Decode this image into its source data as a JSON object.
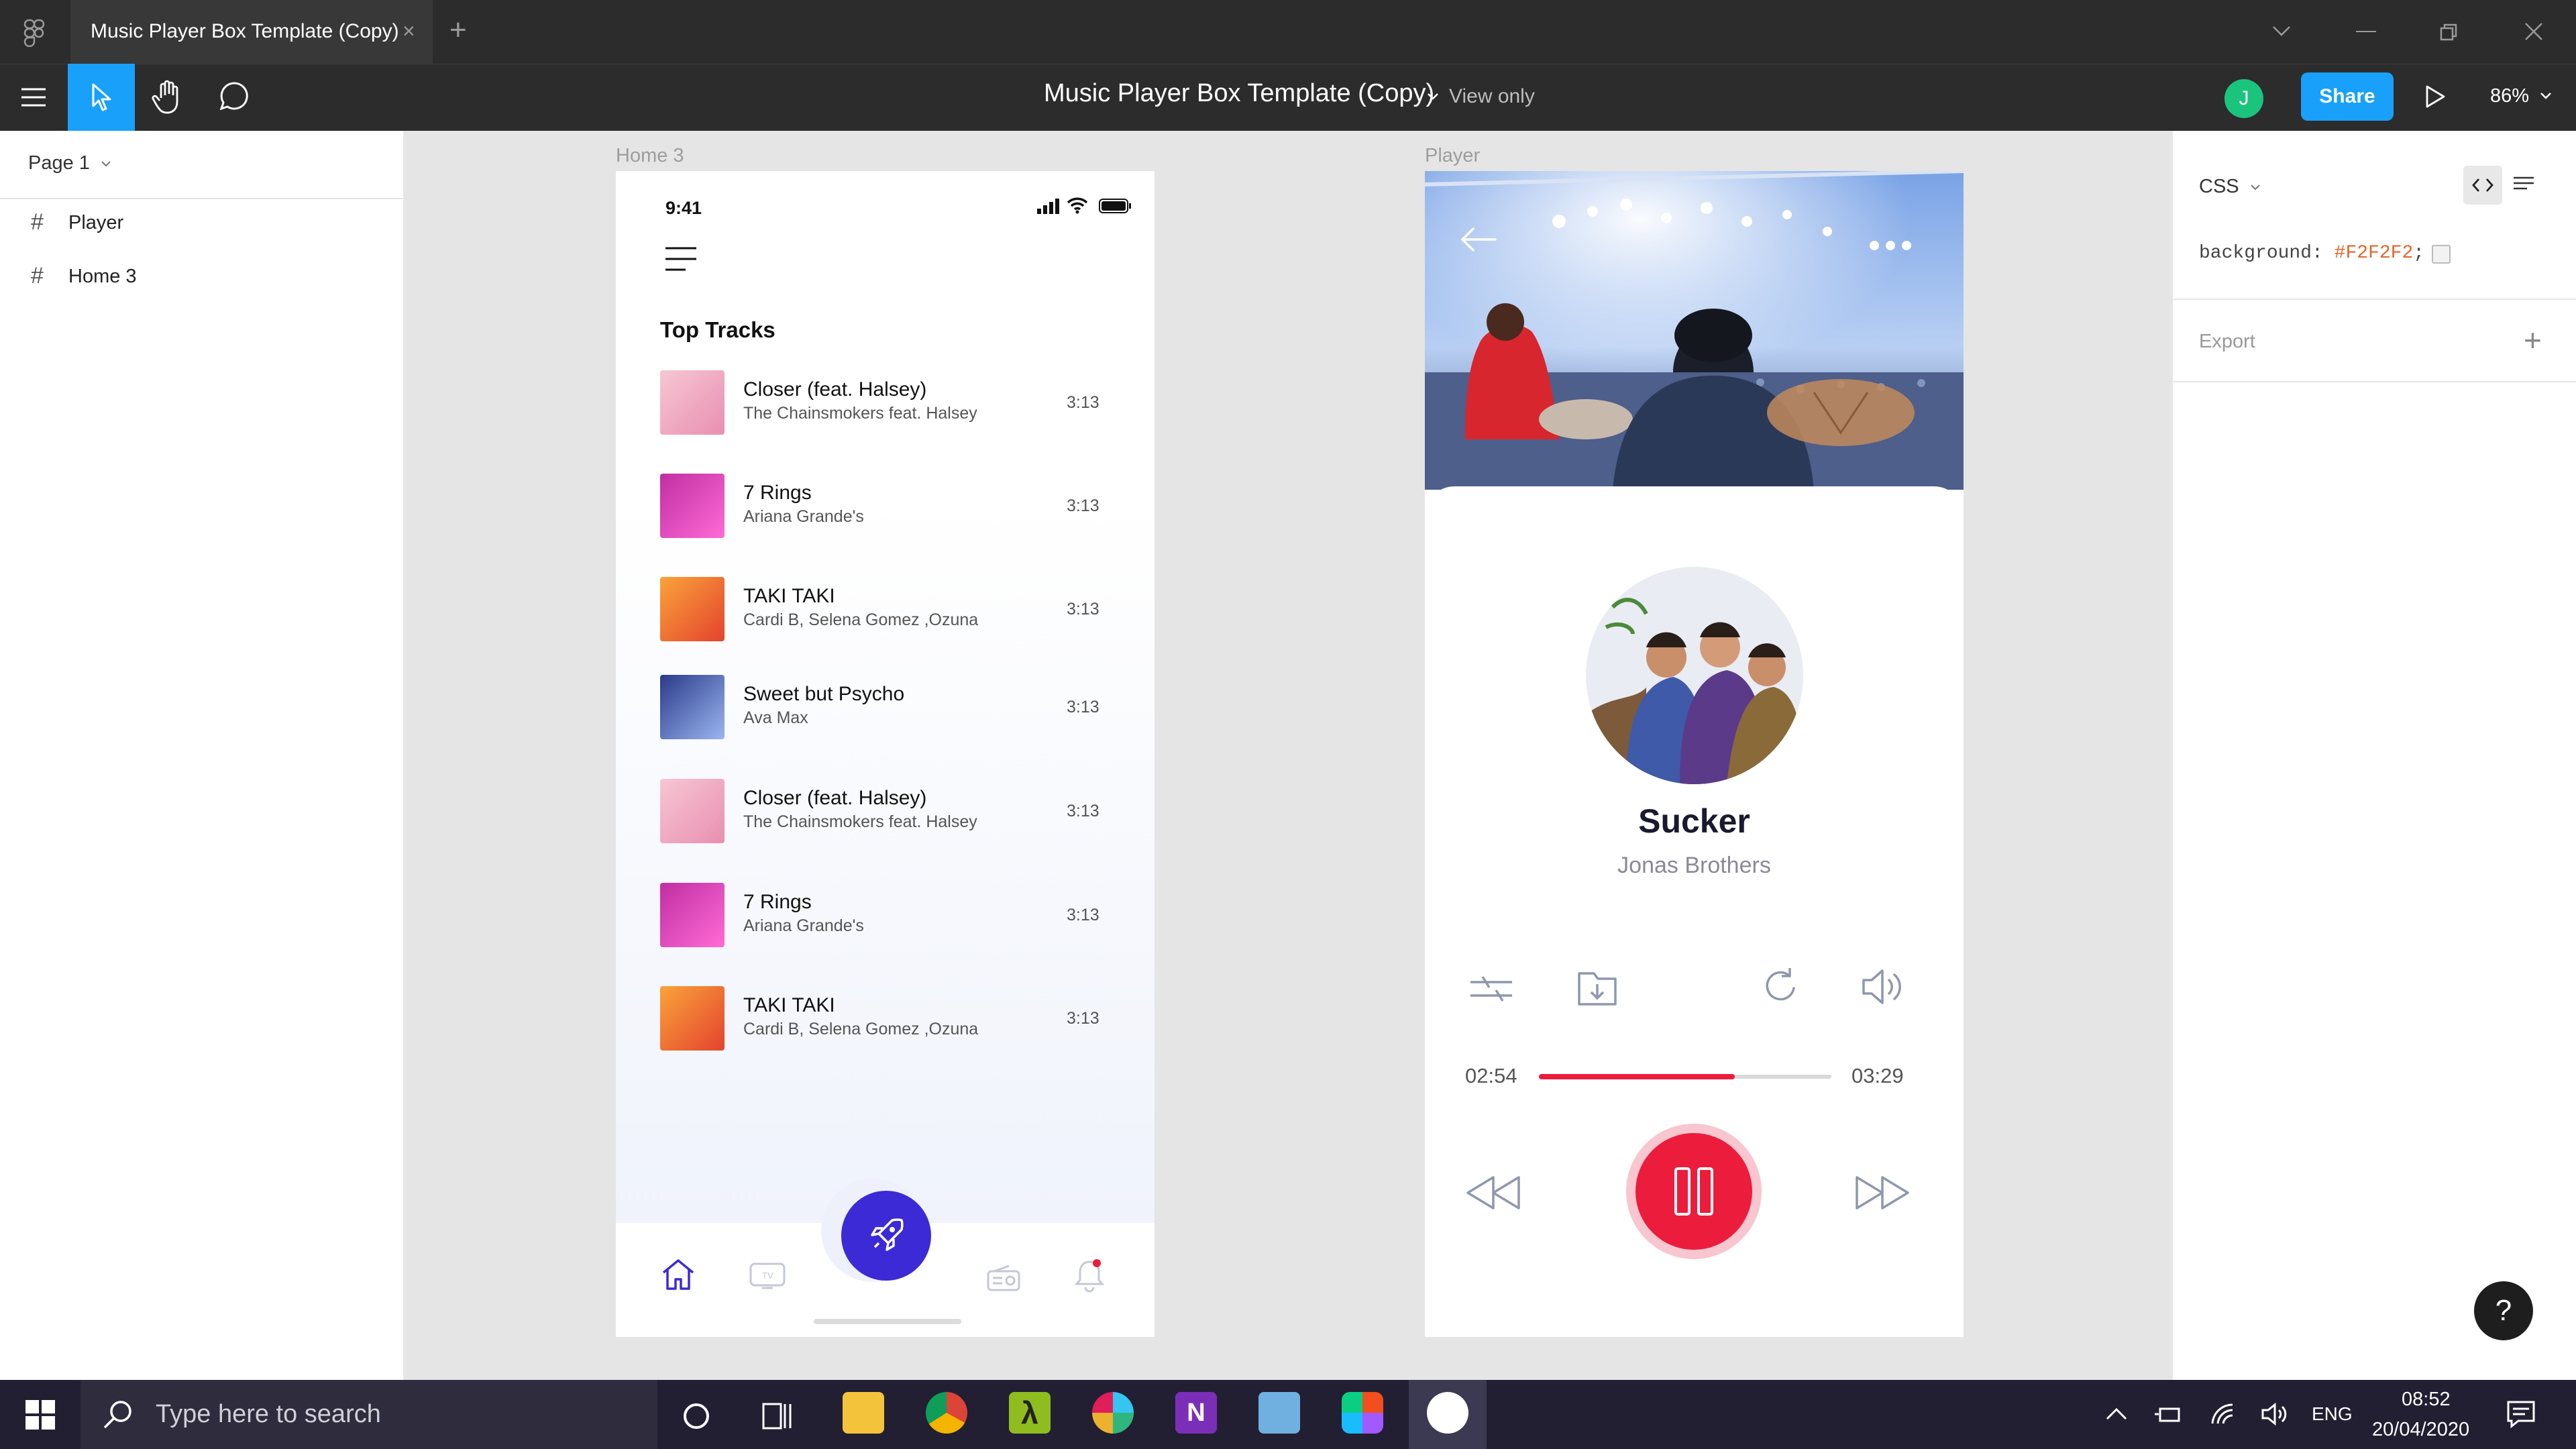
{
  "window": {
    "tab_title": "Music Player Box Template (Copy)",
    "tab_close": "×",
    "new_tab": "+"
  },
  "toolbar": {
    "doc_title": "Music Player Box Template (Copy)",
    "view_mode": "View only",
    "user_initial": "J",
    "share_label": "Share",
    "zoom": "86%"
  },
  "layers": {
    "page": "Page 1",
    "items": [
      {
        "label": "Player"
      },
      {
        "label": "Home 3"
      }
    ]
  },
  "inspect": {
    "mode": "CSS",
    "css_property": "background:",
    "css_value": "#F2F2F2",
    "css_end": ";",
    "export_label": "Export"
  },
  "frames": {
    "home_label": "Home 3",
    "player_label": "Player"
  },
  "home": {
    "status_time": "9:41",
    "section_title": "Top Tracks",
    "tracks": [
      {
        "title": "Closer (feat. Halsey)",
        "artist": "The Chainsmokers feat. Halsey",
        "duration": "3:13",
        "art": "closer"
      },
      {
        "title": "7 Rings",
        "artist": "Ariana Grande's",
        "duration": "3:13",
        "art": "rings"
      },
      {
        "title": "TAKI TAKI",
        "artist": "Cardi B, Selena Gomez ,Ozuna",
        "duration": "3:13",
        "art": "taki"
      },
      {
        "title": "Sweet but Psycho",
        "artist": "Ava Max",
        "duration": "3:13",
        "art": "psycho"
      },
      {
        "title": "Closer (feat. Halsey)",
        "artist": "The Chainsmokers feat. Halsey",
        "duration": "3:13",
        "art": "closer"
      },
      {
        "title": "7 Rings",
        "artist": "Ariana Grande's",
        "duration": "3:13",
        "art": "rings"
      },
      {
        "title": "TAKI TAKI",
        "artist": "Cardi B, Selena Gomez ,Ozuna",
        "duration": "3:13",
        "art": "taki"
      }
    ]
  },
  "player": {
    "song_title": "Sucker",
    "artist": "Jonas Brothers",
    "elapsed": "02:54",
    "total": "03:29",
    "progress_fraction": 0.67,
    "accent_color": "#EC1C3C"
  },
  "taskbar": {
    "search_placeholder": "Type here to search",
    "language": "ENG",
    "time": "08:52",
    "date": "20/04/2020"
  },
  "colors": {
    "figma_blue": "#18A0FB",
    "fab_purple": "#3B2AD6",
    "avatar_green": "#1BC47D"
  }
}
